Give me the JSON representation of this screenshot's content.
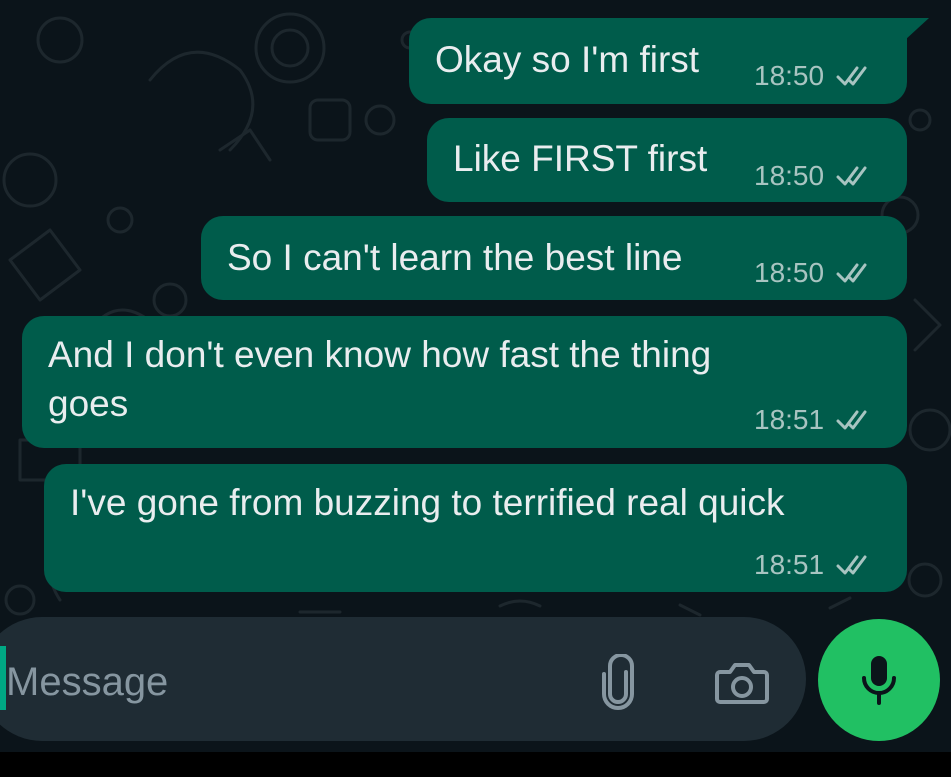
{
  "messages": [
    {
      "text": "Okay so I'm first",
      "time": "18:50",
      "status_icon": "double-check-icon"
    },
    {
      "text": "Like FIRST first",
      "time": "18:50",
      "status_icon": "double-check-icon"
    },
    {
      "text": "So I can't learn the best line",
      "time": "18:50",
      "status_icon": "double-check-icon"
    },
    {
      "text_lines": [
        "And I don't even know how fast the thing",
        "goes"
      ],
      "time": "18:51",
      "status_icon": "double-check-icon"
    },
    {
      "text": "I've gone from buzzing to terrified real quick",
      "time": "18:51",
      "status_icon": "double-check-icon"
    }
  ],
  "composer": {
    "placeholder": "Message",
    "attach_icon": "paperclip-icon",
    "camera_icon": "camera-icon",
    "mic_icon": "microphone-icon"
  },
  "colors": {
    "background": "#0b141a",
    "outgoing_bubble": "#005c4b",
    "composer": "#1f2c34",
    "accent_green": "#21c063",
    "text": "#e9edef",
    "secondary_text": "#8696a0"
  }
}
